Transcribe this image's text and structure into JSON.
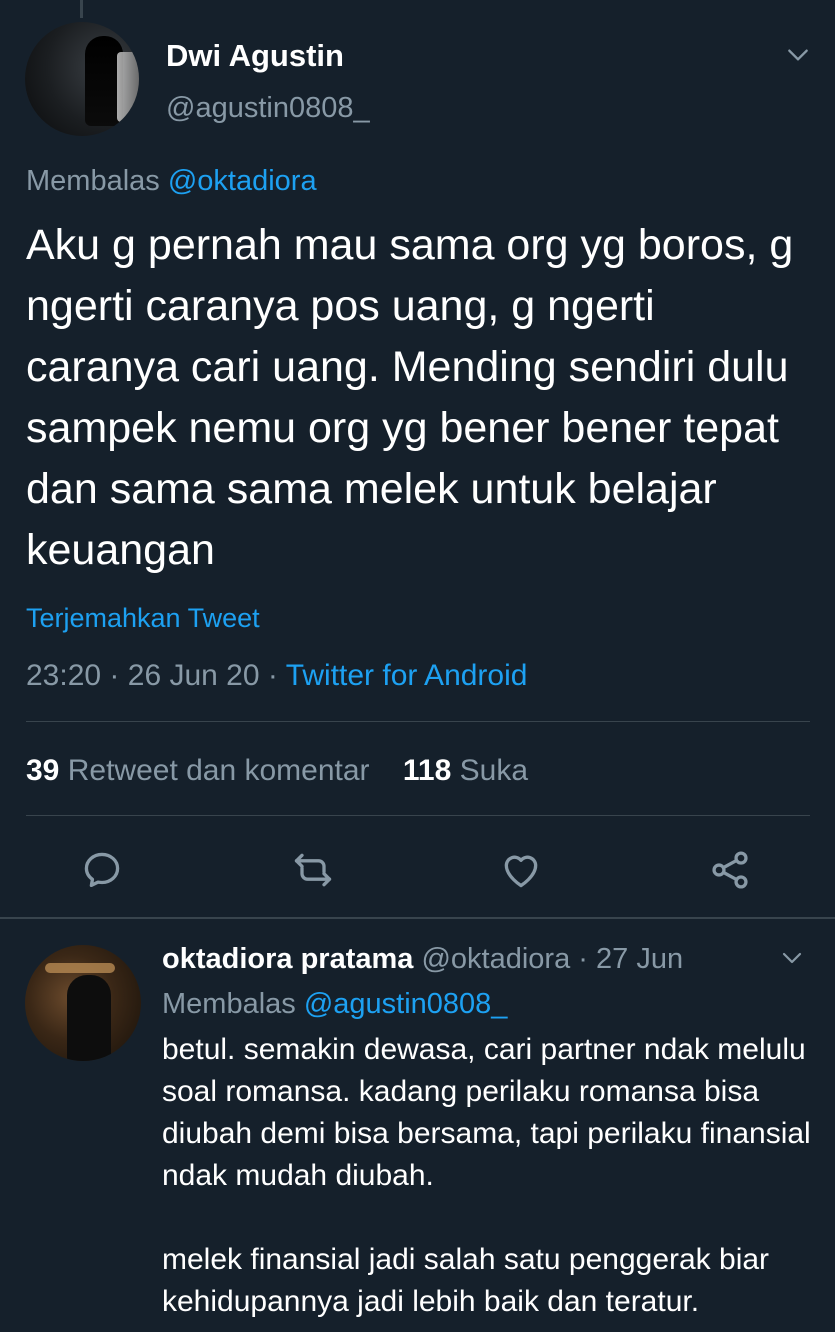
{
  "tweet": {
    "author_name": "Dwi Agustin",
    "author_handle": "@agustin0808_",
    "reply_prefix": "Membalas",
    "reply_to": "@oktadiora",
    "text": "Aku g pernah mau sama org yg boros, g ngerti caranya pos uang, g ngerti caranya cari uang. Mending sendiri dulu sampek nemu org yg bener bener tepat dan sama sama melek untuk belajar keuangan",
    "translate_label": "Terjemahkan Tweet",
    "time": "23:20",
    "date": "26 Jun 20",
    "source": "Twitter for Android",
    "retweets_count": "39",
    "retweets_label": "Retweet dan komentar",
    "likes_count": "118",
    "likes_label": "Suka"
  },
  "actions": {
    "reply_icon": "reply-icon",
    "retweet_icon": "retweet-icon",
    "like_icon": "heart-icon",
    "share_icon": "share-icon"
  },
  "reply": {
    "author_name": "oktadiora pratama",
    "author_handle": "@oktadiora",
    "date": "27 Jun",
    "reply_prefix": "Membalas",
    "reply_to": "@agustin0808_",
    "paragraph1": "betul. semakin dewasa, cari partner ndak melulu soal romansa. kadang perilaku romansa bisa diubah demi bisa bersama, tapi perilaku finansial ndak mudah diubah.",
    "paragraph2": "melek finansial jadi salah satu penggerak biar kehidupannya jadi lebih baik dan teratur."
  },
  "colors": {
    "background": "#15202b",
    "accent": "#1da1f2",
    "secondary_text": "#8899a6",
    "divider": "#38444d"
  }
}
